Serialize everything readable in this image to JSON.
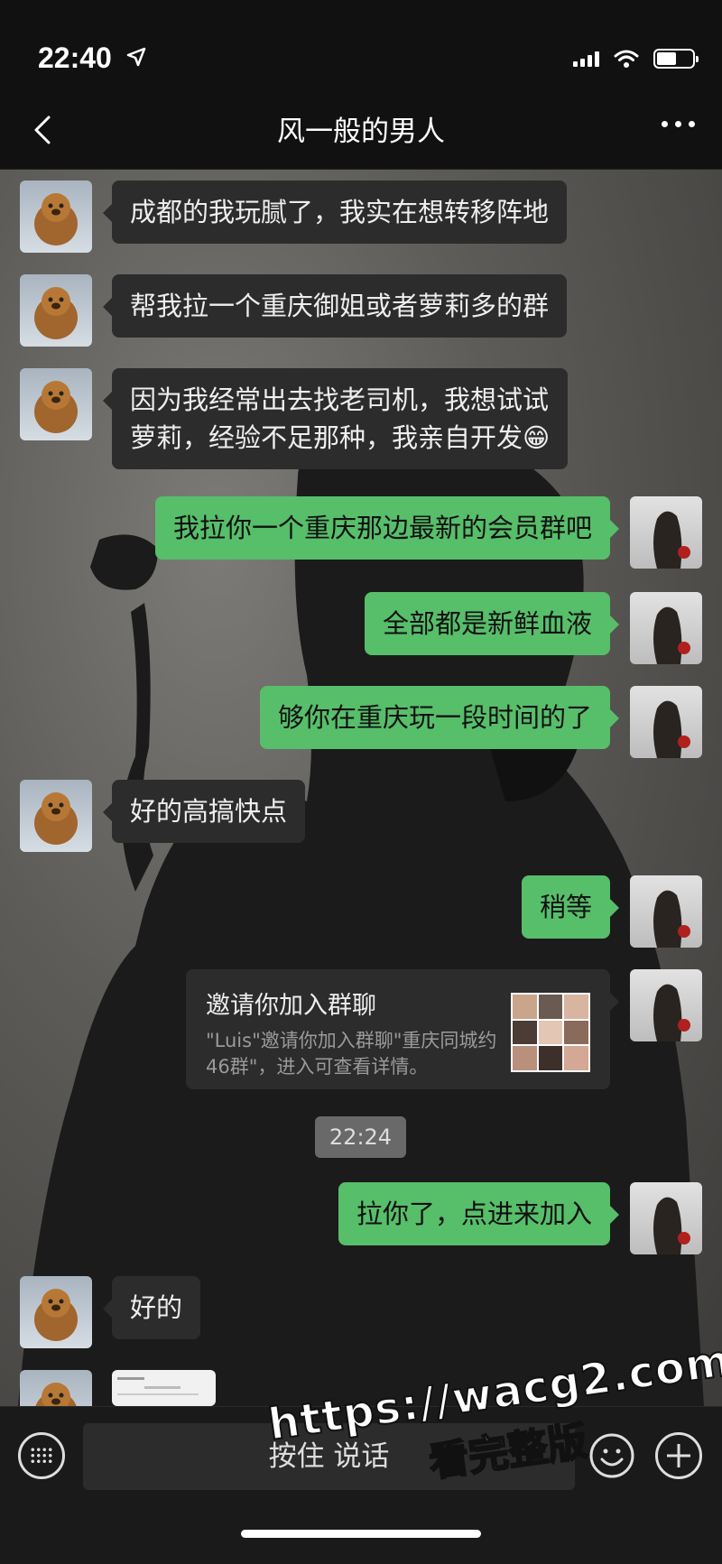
{
  "status_bar": {
    "time": "22:40",
    "battery_level": 0.55
  },
  "header": {
    "title": "风一般的男人"
  },
  "messages": [
    {
      "side": "in",
      "text": "成都的我玩腻了，我实在想转移阵地"
    },
    {
      "side": "in",
      "text": "帮我拉一个重庆御姐或者萝莉多的群"
    },
    {
      "side": "in",
      "line1": "因为我经常出去找老司机，我想试试",
      "line2": "萝莉，经验不足那种，我亲自开发",
      "emoji": "😁"
    },
    {
      "side": "out",
      "text": "我拉你一个重庆那边最新的会员群吧"
    },
    {
      "side": "out",
      "text": "全部都是新鲜血液"
    },
    {
      "side": "out",
      "text": "够你在重庆玩一段时间的了"
    },
    {
      "side": "in",
      "text": "好的高搞快点"
    },
    {
      "side": "out",
      "text": "稍等"
    },
    {
      "side": "out",
      "type": "invite",
      "title": "邀请你加入群聊",
      "desc": "\"Luis\"邀请你加入群聊\"重庆同城约46群\"，进入可查看详情。"
    },
    {
      "side": "out",
      "text": "拉你了，点进来加入"
    },
    {
      "side": "in",
      "text": "好的"
    }
  ],
  "time_divider": "22:24",
  "input_bar": {
    "voice_label": "按住 说话"
  },
  "watermark": {
    "url": "https://wacg2.com",
    "note": "看完整版"
  }
}
